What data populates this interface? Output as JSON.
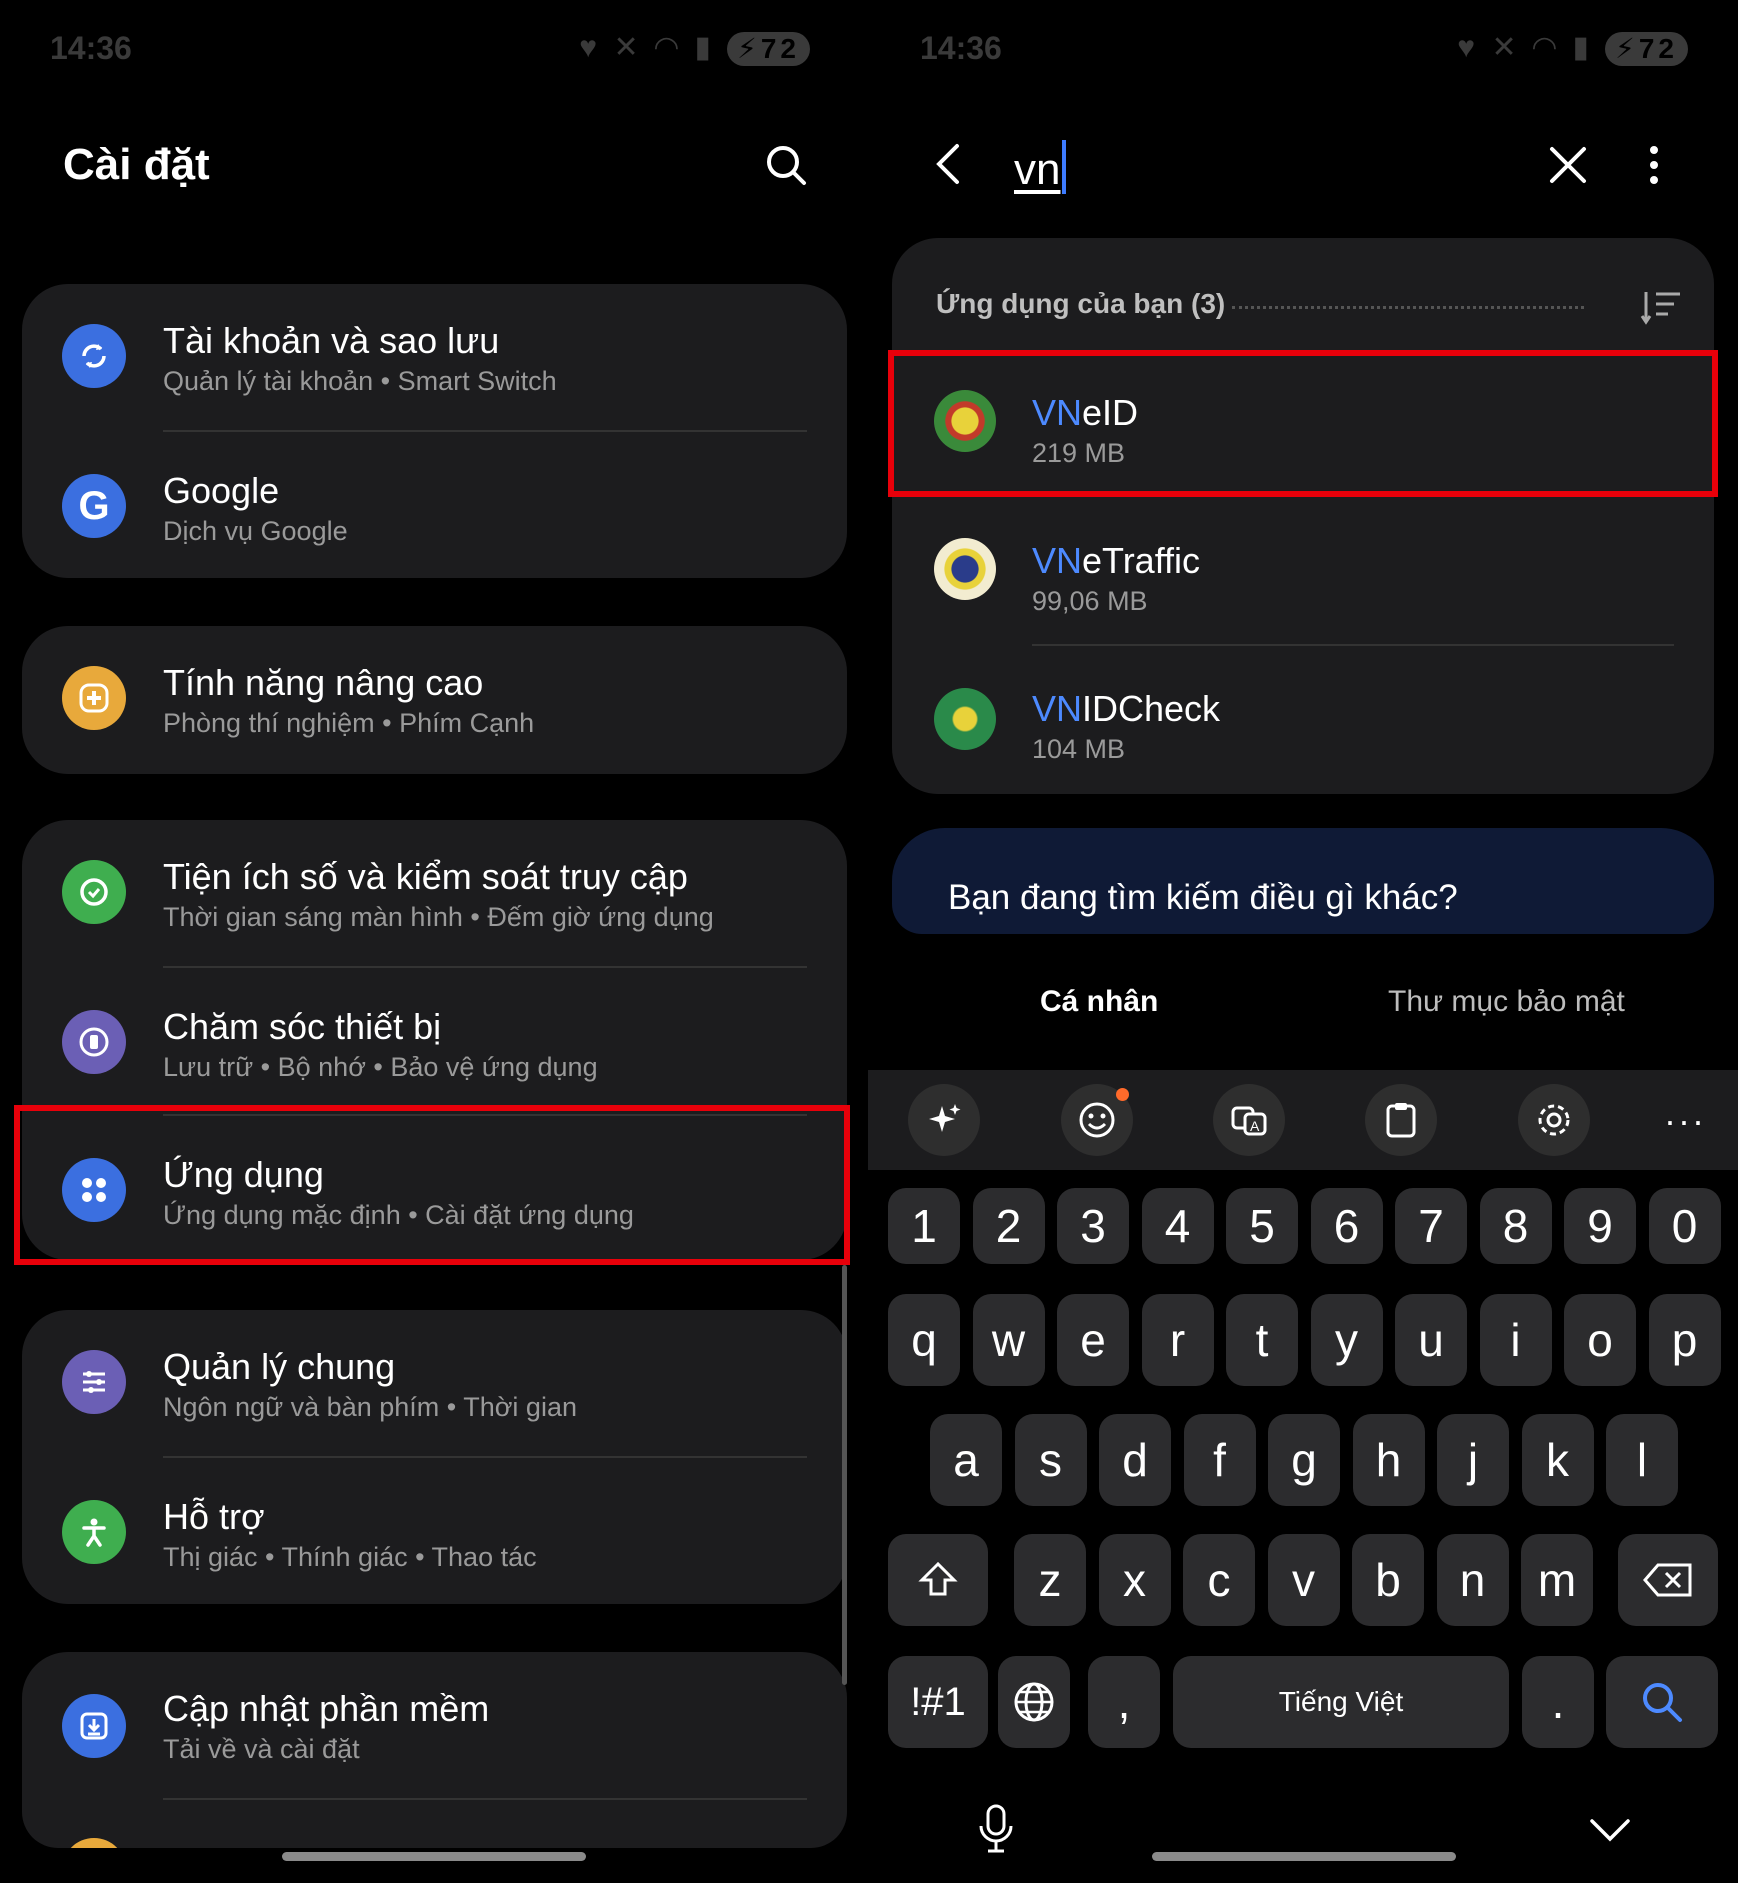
{
  "status_bar": {
    "time": "14:36",
    "battery": "72"
  },
  "left": {
    "title": "Cài đặt",
    "groups": [
      [
        {
          "title": "Tài khoản và sao lưu",
          "subtitle": "Quản lý tài khoản  •  Smart Switch",
          "icon": "sync-icon",
          "color": "#3b6fe0"
        },
        {
          "title": "Google",
          "subtitle": "Dịch vụ Google",
          "icon": "google-g-icon",
          "color": "#3b6fe0"
        }
      ],
      [
        {
          "title": "Tính năng nâng cao",
          "subtitle": "Phòng thí nghiệm  •  Phím Cạnh",
          "icon": "puzzle-plus-icon",
          "color": "#e8a93b"
        }
      ],
      [
        {
          "title": "Tiện ích số và kiểm soát truy cập",
          "subtitle": "Thời gian sáng màn hình  •  Đếm giờ ứng dụng",
          "icon": "digital-wellbeing-icon",
          "color": "#3fae4f"
        },
        {
          "title": "Chăm sóc thiết bị",
          "subtitle": "Lưu trữ  •  Bộ nhớ  •  Bảo vệ ứng dụng",
          "icon": "device-care-icon",
          "color": "#6b5fb5"
        },
        {
          "title": "Ứng dụng",
          "subtitle": "Ứng dụng mặc định  •  Cài đặt ứng dụng",
          "icon": "apps-grid-icon",
          "color": "#3b6fe0"
        }
      ],
      [
        {
          "title": "Quản lý chung",
          "subtitle": "Ngôn ngữ và bàn phím  •  Thời gian",
          "icon": "sliders-icon",
          "color": "#6b5fb5"
        },
        {
          "title": "Hỗ trợ",
          "subtitle": "Thị giác  •  Thính giác  •  Thao tác",
          "icon": "accessibility-icon",
          "color": "#3fae4f"
        }
      ],
      [
        {
          "title": "Cập nhật phần mềm",
          "subtitle": "Tải về và cài đặt",
          "icon": "download-icon",
          "color": "#3b6fe0"
        }
      ]
    ]
  },
  "right": {
    "search_query": "vn",
    "section_header": "Ứng dụng của bạn (3)",
    "apps": [
      {
        "highlight": "VN",
        "rest": "eID",
        "size": "219 MB",
        "icon": "vneid-app-icon"
      },
      {
        "highlight": "VN",
        "rest": "eTraffic",
        "size": "99,06 MB",
        "icon": "vnetraffic-app-icon"
      },
      {
        "highlight": "VN",
        "rest": "IDCheck",
        "size": "104 MB",
        "icon": "vnidcheck-app-icon"
      }
    ],
    "suggest": "Bạn đang tìm kiếm điều gì khác?",
    "tabs": [
      "Cá nhân",
      "Thư mục bảo mật"
    ],
    "keyboard": {
      "numbers": [
        "1",
        "2",
        "3",
        "4",
        "5",
        "6",
        "7",
        "8",
        "9",
        "0"
      ],
      "row1": [
        "q",
        "w",
        "e",
        "r",
        "t",
        "y",
        "u",
        "i",
        "o",
        "p"
      ],
      "row2": [
        "a",
        "s",
        "d",
        "f",
        "g",
        "h",
        "j",
        "k",
        "l"
      ],
      "row3": [
        "z",
        "x",
        "c",
        "v",
        "b",
        "n",
        "m"
      ],
      "sym": "!#1",
      "comma": ",",
      "space": "Tiếng Việt",
      "period": "."
    }
  }
}
